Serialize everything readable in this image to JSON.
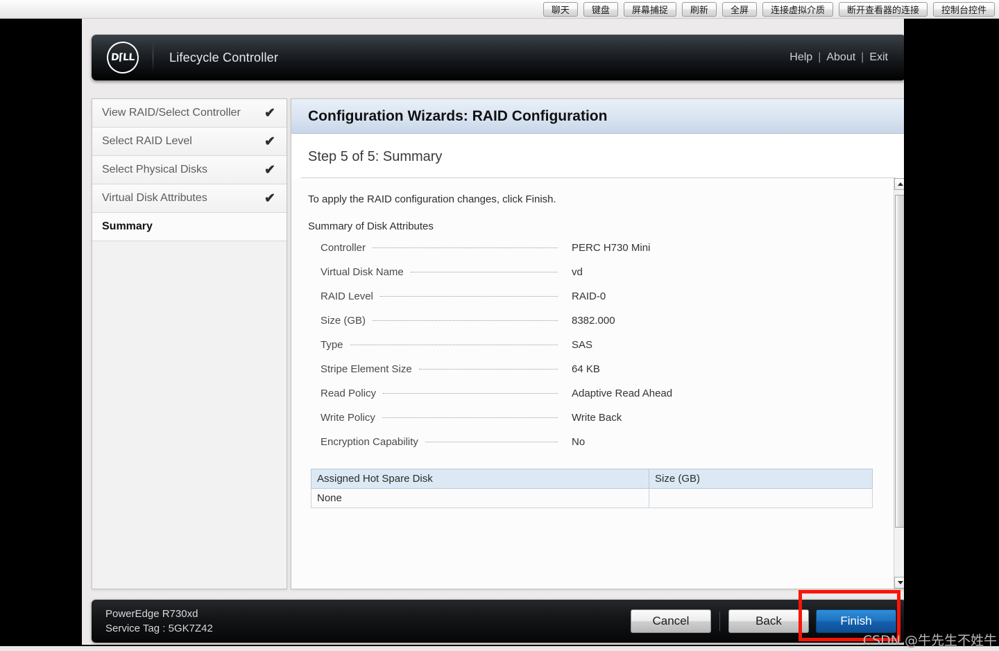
{
  "viewer_toolbar": {
    "buttons": [
      {
        "label": "聊天",
        "name": "chat"
      },
      {
        "label": "键盘",
        "name": "keyboard"
      },
      {
        "label": "屏幕捕捉",
        "name": "screen-capture"
      },
      {
        "label": "刷新",
        "name": "refresh"
      },
      {
        "label": "全屏",
        "name": "fullscreen"
      },
      {
        "label": "连接虚拟介质",
        "name": "connect-virtual-media"
      },
      {
        "label": "断开查看器的连接",
        "name": "disconnect-viewer"
      },
      {
        "label": "控制台控件",
        "name": "console-controls"
      }
    ]
  },
  "header": {
    "logo_text": "D⌈LL",
    "title": "Lifecycle Controller",
    "links": [
      {
        "label": "Help"
      },
      {
        "label": "About"
      },
      {
        "label": "Exit"
      }
    ],
    "link_divider": "|"
  },
  "sidebar": {
    "items": [
      {
        "label": "View RAID/Select Controller",
        "checked": true,
        "active": false
      },
      {
        "label": "Select RAID Level",
        "checked": true,
        "active": false
      },
      {
        "label": "Select Physical Disks",
        "checked": true,
        "active": false
      },
      {
        "label": "Virtual Disk Attributes",
        "checked": true,
        "active": false
      },
      {
        "label": "Summary",
        "checked": false,
        "active": true
      }
    ],
    "check_glyph": "✔"
  },
  "content": {
    "panel_title": "Configuration Wizards: RAID Configuration",
    "step_title": "Step 5 of 5: Summary",
    "intro": "To apply the RAID configuration changes, click Finish.",
    "subhead": "Summary of Disk Attributes",
    "attributes": [
      {
        "key": "Controller",
        "value": "PERC H730 Mini"
      },
      {
        "key": "Virtual Disk Name",
        "value": "vd"
      },
      {
        "key": "RAID Level",
        "value": "RAID-0"
      },
      {
        "key": "Size (GB)",
        "value": "8382.000"
      },
      {
        "key": "Type",
        "value": "SAS"
      },
      {
        "key": "Stripe Element Size",
        "value": "64 KB"
      },
      {
        "key": "Read Policy",
        "value": "Adaptive Read Ahead"
      },
      {
        "key": "Write Policy",
        "value": "Write Back"
      },
      {
        "key": "Encryption Capability",
        "value": "No"
      }
    ],
    "hotspare_table": {
      "columns": [
        "Assigned Hot Spare Disk",
        "Size (GB)"
      ],
      "rows": [
        [
          "None",
          ""
        ]
      ]
    }
  },
  "footer": {
    "model": "PowerEdge R730xd",
    "service_tag": "Service Tag : 5GK7Z42",
    "buttons": [
      {
        "label": "Cancel",
        "name": "cancel",
        "primary": false
      },
      {
        "label": "Back",
        "name": "back",
        "primary": false
      },
      {
        "label": "Finish",
        "name": "finish",
        "primary": true
      }
    ]
  },
  "annotation": {
    "highlight_color": "#fa1408"
  },
  "watermark": "CSDN @牛先生不姓牛"
}
